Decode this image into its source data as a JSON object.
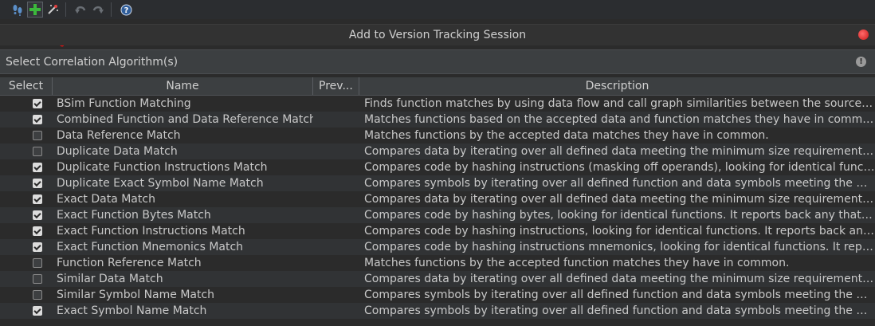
{
  "toolbar": {
    "icons": [
      "footprints-icon",
      "add-icon",
      "wizard-wand-icon",
      "undo-icon",
      "redo-icon",
      "help-icon"
    ],
    "help_glyph": "?"
  },
  "dialog": {
    "title": "Add to Version Tracking Session",
    "close_color": "#e02020"
  },
  "section": {
    "title": "Select Correlation Algorithm(s)",
    "info_glyph": "!"
  },
  "table": {
    "headers": {
      "select": "Select",
      "name": "Name",
      "preview": "Prev...",
      "description": "Description"
    },
    "rows": [
      {
        "checked": true,
        "name": "BSim Function Matching",
        "description": "Finds function matches by using data flow and call graph similarities between the source and ..."
      },
      {
        "checked": true,
        "name": "Combined Function and Data Reference Match",
        "description": "Matches functions based on the accepted data and function matches they have in common."
      },
      {
        "checked": false,
        "name": "Data Reference Match",
        "description": "Matches functions by the accepted data matches they have in common."
      },
      {
        "checked": false,
        "name": "Duplicate Data Match",
        "description": "Compares data by iterating over all defined data meeting the minimum size requirement in th..."
      },
      {
        "checked": true,
        "name": "Duplicate Function Instructions Match",
        "description": "Compares code by hashing instructions (masking off operands), looking for identical functio..."
      },
      {
        "checked": true,
        "name": "Duplicate Exact Symbol Name Match",
        "description": "Compares symbols by iterating over all defined function and data symbols meeting the mini..."
      },
      {
        "checked": true,
        "name": "Exact Data Match",
        "description": "Compares data by iterating over all defined data meeting the minimum size requirement in th..."
      },
      {
        "checked": true,
        "name": "Exact Function Bytes Match",
        "description": "Compares code by hashing bytes, looking for identical functions. It reports back any that have..."
      },
      {
        "checked": true,
        "name": "Exact Function Instructions Match",
        "description": "Compares code by hashing instructions, looking for identical functions. It reports back any th..."
      },
      {
        "checked": true,
        "name": "Exact Function Mnemonics Match",
        "description": "Compares code by hashing instructions mnemonics, looking for identical functions. It reports..."
      },
      {
        "checked": false,
        "name": "Function Reference Match",
        "description": "Matches functions by the accepted function matches they have in common."
      },
      {
        "checked": false,
        "name": "Similar Data Match",
        "description": "Compares data by iterating over all defined data meeting the minimum size requirement in th..."
      },
      {
        "checked": false,
        "name": "Similar Symbol Name Match",
        "description": "Compares symbols by iterating over all defined function and data symbols meeting the mini..."
      },
      {
        "checked": true,
        "name": "Exact Symbol Name Match",
        "description": "Compares symbols by iterating over all defined function and data symbols meeting the mini..."
      }
    ]
  }
}
